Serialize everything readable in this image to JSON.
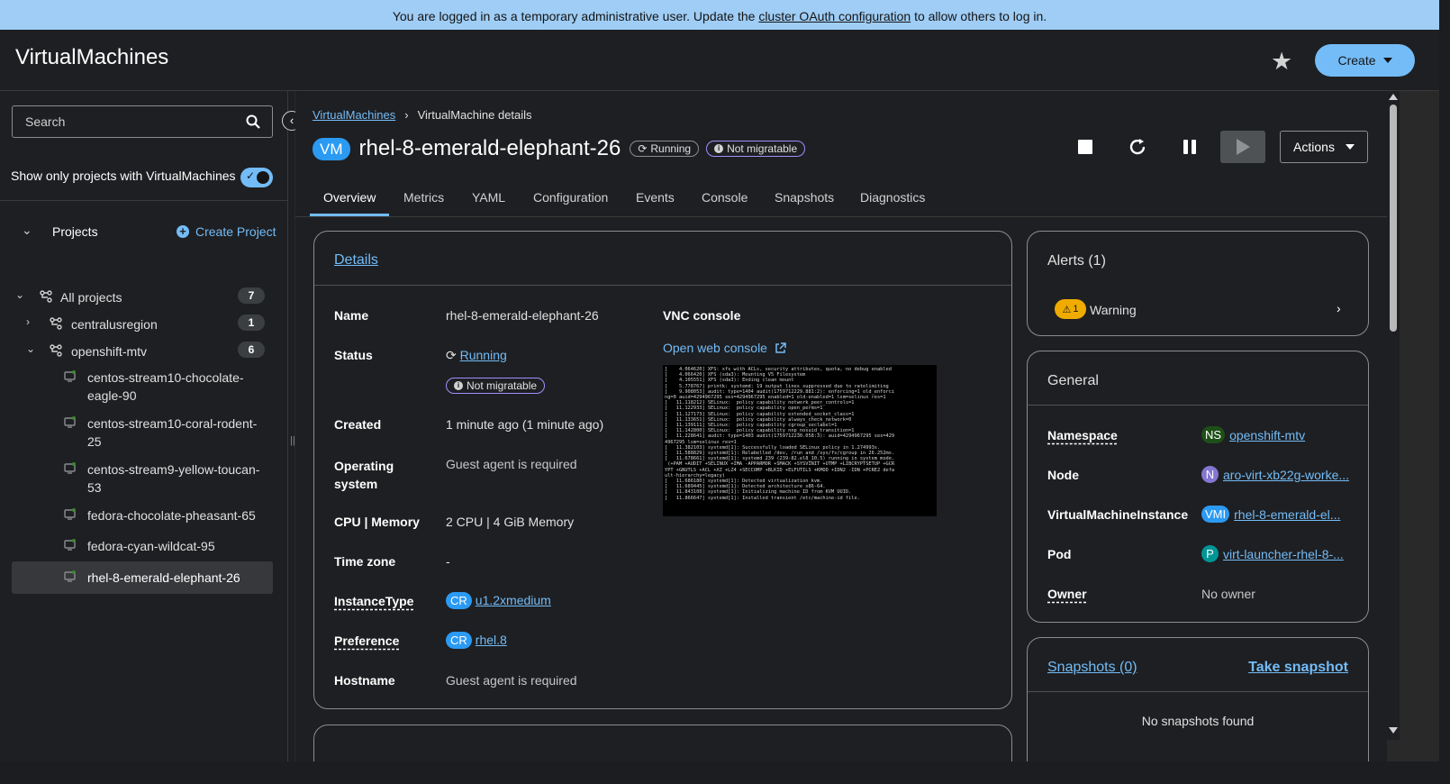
{
  "banner": {
    "text_before": "You are logged in as a temporary administrative user. Update the ",
    "link": "cluster OAuth configuration",
    "text_after": " to allow others to log in."
  },
  "masthead": {
    "title": "VirtualMachines",
    "create_label": "Create"
  },
  "sidebar": {
    "search_placeholder": "Search",
    "toggle_label": "Show only projects with VirtualMachines",
    "toggle_on": true,
    "projects_label": "Projects",
    "create_project_label": "Create Project",
    "tree": [
      {
        "name": "All projects",
        "count": "7",
        "expanded": true
      },
      {
        "name": "centralusregion",
        "count": "1",
        "expanded": false
      },
      {
        "name": "openshift-mtv",
        "count": "6",
        "expanded": true
      }
    ],
    "vms": [
      "centos-stream10-chocolate-eagle-90",
      "centos-stream10-coral-rodent-25",
      "centos-stream9-yellow-toucan-53",
      "fedora-chocolate-pheasant-65",
      "fedora-cyan-wildcat-95",
      "rhel-8-emerald-elephant-26"
    ],
    "selected_vm": "rhel-8-emerald-elephant-26"
  },
  "breadcrumb": {
    "root": "VirtualMachines",
    "current": "VirtualMachine details"
  },
  "vm": {
    "badge": "VM",
    "name": "rhel-8-emerald-elephant-26",
    "status": "Running",
    "migratable": "Not migratable"
  },
  "toolbar": {
    "actions_label": "Actions"
  },
  "tabs": [
    "Overview",
    "Metrics",
    "YAML",
    "Configuration",
    "Events",
    "Console",
    "Snapshots",
    "Diagnostics"
  ],
  "active_tab": "Overview",
  "details": {
    "title": "Details",
    "rows": {
      "name_label": "Name",
      "name_value": "rhel-8-emerald-elephant-26",
      "status_label": "Status",
      "status_value": "Running",
      "status_badge": "Not migratable",
      "created_label": "Created",
      "created_value": "1 minute ago (1 minute ago)",
      "os_label": "Operating system",
      "os_value": "Guest agent is required",
      "cpu_label": "CPU | Memory",
      "cpu_value": "2 CPU | 4 GiB Memory",
      "tz_label": "Time zone",
      "tz_value": "-",
      "instancetype_label": "InstanceType",
      "instancetype_badge": "CR",
      "instancetype_value": "u1.2xmedium",
      "preference_label": "Preference",
      "preference_badge": "CR",
      "preference_value": "rhel.8",
      "hostname_label": "Hostname",
      "hostname_value": "Guest agent is required"
    },
    "vnc_title": "VNC console",
    "vnc_link": "Open web console"
  },
  "alerts": {
    "title": "Alerts (1)",
    "warning_count": "1",
    "warning_label": "Warning"
  },
  "general": {
    "title": "General",
    "namespace_label": "Namespace",
    "namespace_badge": "NS",
    "namespace_value": "openshift-mtv",
    "node_label": "Node",
    "node_badge": "N",
    "node_value": "aro-virt-xb22g-worke...",
    "vmi_label": "VirtualMachineInstance",
    "vmi_badge": "VMI",
    "vmi_value": "rhel-8-emerald-el...",
    "pod_label": "Pod",
    "pod_badge": "P",
    "pod_value": "virt-launcher-rhel-8-...",
    "owner_label": "Owner",
    "owner_value": "No owner"
  },
  "snapshots": {
    "title": "Snapshots (0)",
    "take_label": "Take snapshot",
    "empty_label": "No snapshots found"
  },
  "colors": {
    "accent": "#73bcf7",
    "banner": "#9fcdf5",
    "warning": "#f0ab00"
  }
}
